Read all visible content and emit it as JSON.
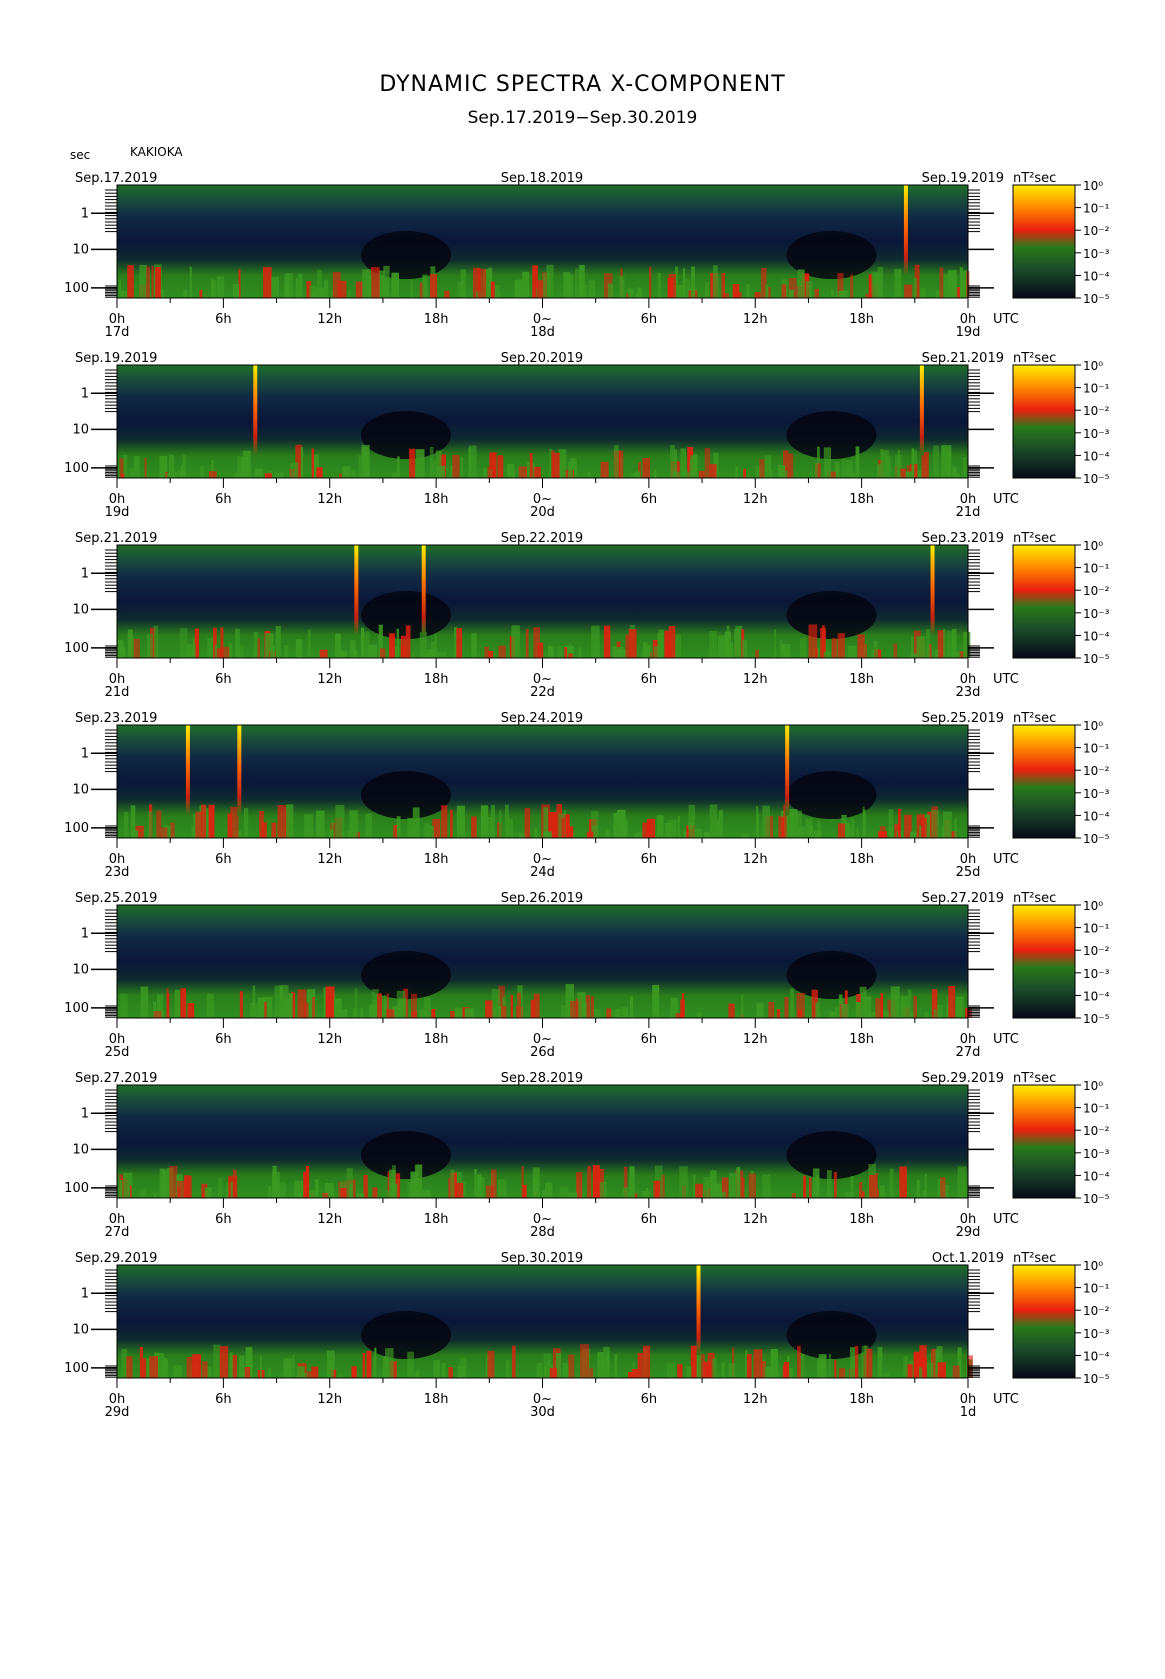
{
  "title": "DYNAMIC SPECTRA X-COMPONENT",
  "subtitle": "Sep.17.2019−Sep.30.2019",
  "y_unit": "sec",
  "station": "KAKIOKA",
  "colorbar_unit": "nT²sec",
  "time_unit": "UTC",
  "hour_labels": [
    "0h",
    "6h",
    "12h",
    "18h",
    "0~",
    "6h",
    "12h",
    "18h",
    "0h"
  ],
  "period_ticks": [
    "1",
    "10",
    "100"
  ],
  "colorbar_ticks": [
    "10⁰",
    "10⁻¹",
    "10⁻²",
    "10⁻³",
    "10⁻⁴",
    "10⁻⁵"
  ],
  "colors": {
    "low": "#0a0a28",
    "mid": "#1f6e1f",
    "high": "#e22010",
    "max": "#ffee00"
  },
  "chart_data": {
    "type": "heatmap",
    "x_axis": "time (UTC hours)",
    "y_axis": "period (sec, log scale, 1 to 100+)",
    "color_scale": "log power nT²sec, 1e-5 to 1e0",
    "panels": [
      {
        "left_date": "Sep.17.2019",
        "mid_date": "Sep.18.2019",
        "right_date": "Sep.19.2019",
        "day_start": "17d",
        "day_mid": "18d",
        "day_end": "19d",
        "spikes_hours": [
          44.5
        ]
      },
      {
        "left_date": "Sep.19.2019",
        "mid_date": "Sep.20.2019",
        "right_date": "Sep.21.2019",
        "day_start": "19d",
        "day_mid": "20d",
        "day_end": "21d",
        "spikes_hours": [
          7.8,
          45.4
        ]
      },
      {
        "left_date": "Sep.21.2019",
        "mid_date": "Sep.22.2019",
        "right_date": "Sep.23.2019",
        "day_start": "21d",
        "day_mid": "22d",
        "day_end": "23d",
        "spikes_hours": [
          13.5,
          17.3,
          46.0
        ]
      },
      {
        "left_date": "Sep.23.2019",
        "mid_date": "Sep.24.2019",
        "right_date": "Sep.25.2019",
        "day_start": "23d",
        "day_mid": "24d",
        "day_end": "25d",
        "spikes_hours": [
          4.0,
          6.9,
          37.8
        ]
      },
      {
        "left_date": "Sep.25.2019",
        "mid_date": "Sep.26.2019",
        "right_date": "Sep.27.2019",
        "day_start": "25d",
        "day_mid": "26d",
        "day_end": "27d",
        "spikes_hours": []
      },
      {
        "left_date": "Sep.27.2019",
        "mid_date": "Sep.28.2019",
        "right_date": "Sep.29.2019",
        "day_start": "27d",
        "day_mid": "28d",
        "day_end": "29d",
        "spikes_hours": []
      },
      {
        "left_date": "Sep.29.2019",
        "mid_date": "Sep.30.2019",
        "right_date": "Oct.1.2019",
        "day_start": "29d",
        "day_mid": "30d",
        "day_end": "1d",
        "spikes_hours": [
          32.8
        ]
      }
    ]
  }
}
